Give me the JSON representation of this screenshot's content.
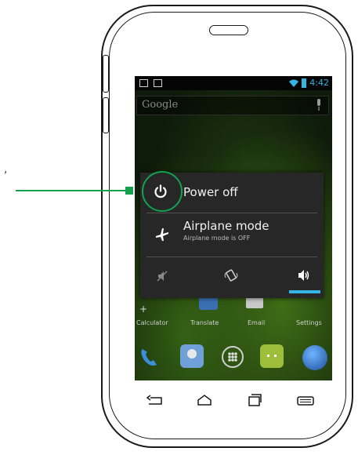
{
  "status_bar": {
    "time": "4:42"
  },
  "search_bar": {
    "label": "Google"
  },
  "power_menu": {
    "power_off_label": "Power off",
    "airplane_mode_label": "Airplane mode",
    "airplane_mode_status": "Airplane mode is OFF",
    "sound_modes": [
      "silent-icon",
      "vibrate-icon",
      "sound-on-icon"
    ],
    "selected_sound_mode": "sound-on-icon"
  },
  "home_apps": [
    "Calculator",
    "Translate",
    "Email",
    "Settings"
  ],
  "dock_icons": [
    "phone-icon",
    "contacts-icon",
    "app-drawer-icon",
    "messaging-icon",
    "browser-icon"
  ],
  "nav_bar": [
    "back-icon",
    "home-icon",
    "recent-apps-icon",
    "menu-icon"
  ],
  "colors": {
    "annotation": "#15a04f",
    "accent": "#33b5e5",
    "dialog_bg": "#272727"
  },
  "left_mark": ","
}
